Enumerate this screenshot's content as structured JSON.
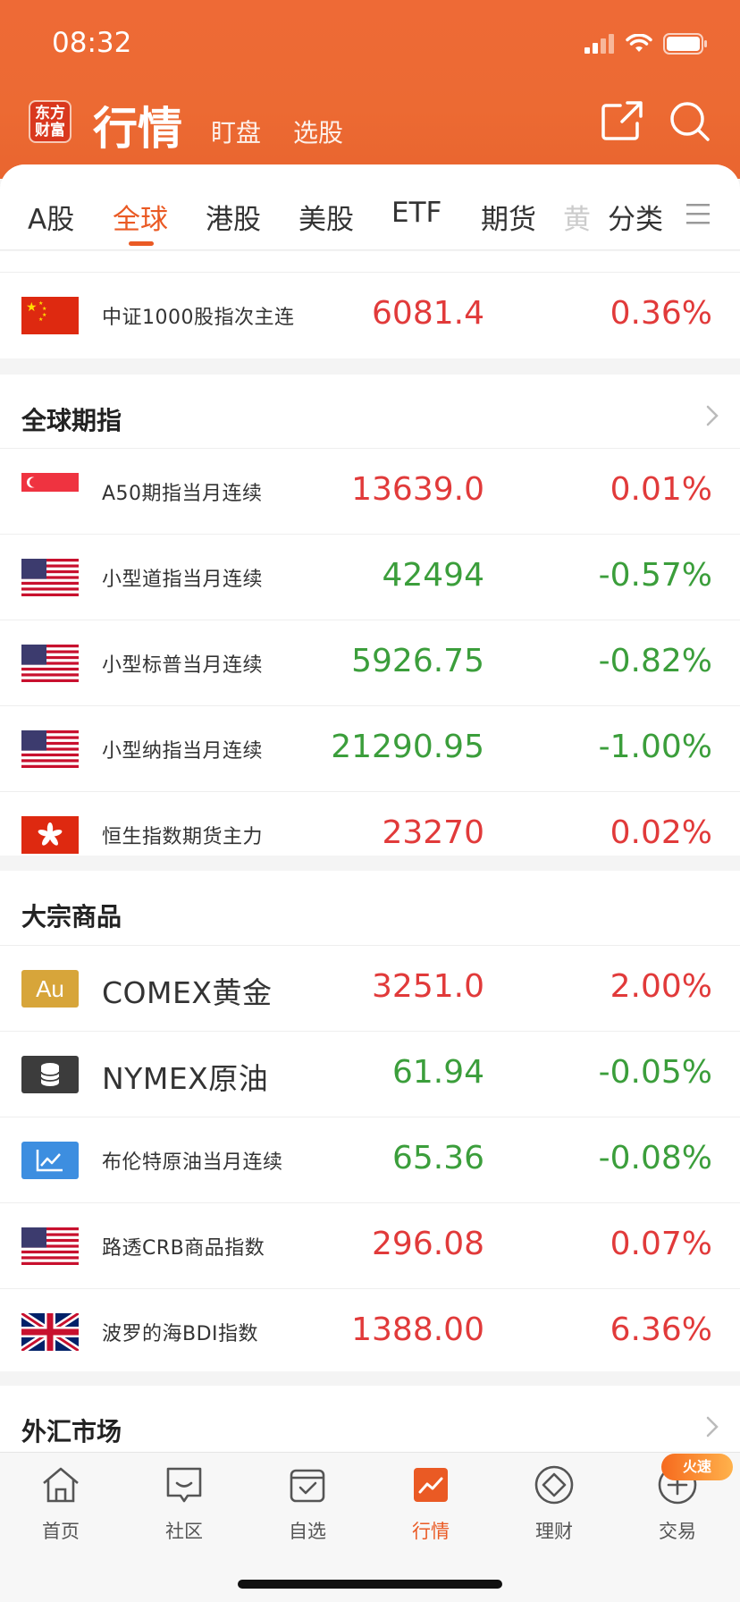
{
  "status_bar": {
    "time": "08:32"
  },
  "header": {
    "logo_text": "东方财富",
    "title": "行情",
    "sub_tabs": [
      "盯盘",
      "选股"
    ]
  },
  "tabs": [
    "A股",
    "全球",
    "港股",
    "美股",
    "ETF",
    "期货",
    "黄",
    "分类"
  ],
  "active_tab": "全球",
  "top_row": {
    "name": "中证1000股指次主连",
    "price": "6081.4",
    "pct": "0.36%",
    "trend": "up",
    "flag": "cn-flag-icon"
  },
  "sections": [
    {
      "title": "全球期指",
      "rows": [
        {
          "name": "A50期指当月连续",
          "price": "13639.0",
          "pct": "0.01%",
          "trend": "up",
          "flag": "sg-flag-icon"
        },
        {
          "name": "小型道指当月连续",
          "price": "42494",
          "pct": "-0.57%",
          "trend": "down",
          "flag": "us-flag-icon"
        },
        {
          "name": "小型标普当月连续",
          "price": "5926.75",
          "pct": "-0.82%",
          "trend": "down",
          "flag": "us-flag-icon"
        },
        {
          "name": "小型纳指当月连续",
          "price": "21290.95",
          "pct": "-1.00%",
          "trend": "down",
          "flag": "us-flag-icon"
        },
        {
          "name": "恒生指数期货主力",
          "price": "23270",
          "pct": "0.02%",
          "trend": "up",
          "flag": "hk-flag-icon"
        }
      ]
    },
    {
      "title": "大宗商品",
      "rows": [
        {
          "name": "COMEX黄金",
          "price": "3251.0",
          "pct": "2.00%",
          "trend": "up",
          "flag": "gold-icon",
          "badge": "Au"
        },
        {
          "name": "NYMEX原油",
          "price": "61.94",
          "pct": "-0.05%",
          "trend": "down",
          "flag": "oil-barrel-icon"
        },
        {
          "name": "布伦特原油当月连续",
          "price": "65.36",
          "pct": "-0.08%",
          "trend": "down",
          "flag": "line-chart-icon"
        },
        {
          "name": "路透CRB商品指数",
          "price": "296.08",
          "pct": "0.07%",
          "trend": "up",
          "flag": "us-flag-icon"
        },
        {
          "name": "波罗的海BDI指数",
          "price": "1388.00",
          "pct": "6.36%",
          "trend": "up",
          "flag": "uk-flag-icon"
        }
      ]
    },
    {
      "title": "外汇市场"
    }
  ],
  "bottom_nav": [
    {
      "label": "首页",
      "icon": "home-icon"
    },
    {
      "label": "社区",
      "icon": "chat-icon"
    },
    {
      "label": "自选",
      "icon": "checkbox-icon"
    },
    {
      "label": "行情",
      "icon": "market-icon"
    },
    {
      "label": "理财",
      "icon": "diamond-icon"
    },
    {
      "label": "交易",
      "icon": "trade-icon"
    }
  ],
  "hot_badge": "火速",
  "colors": {
    "accent": "#ea5a24",
    "up": "#e13a3a",
    "down": "#3b9e3b"
  }
}
